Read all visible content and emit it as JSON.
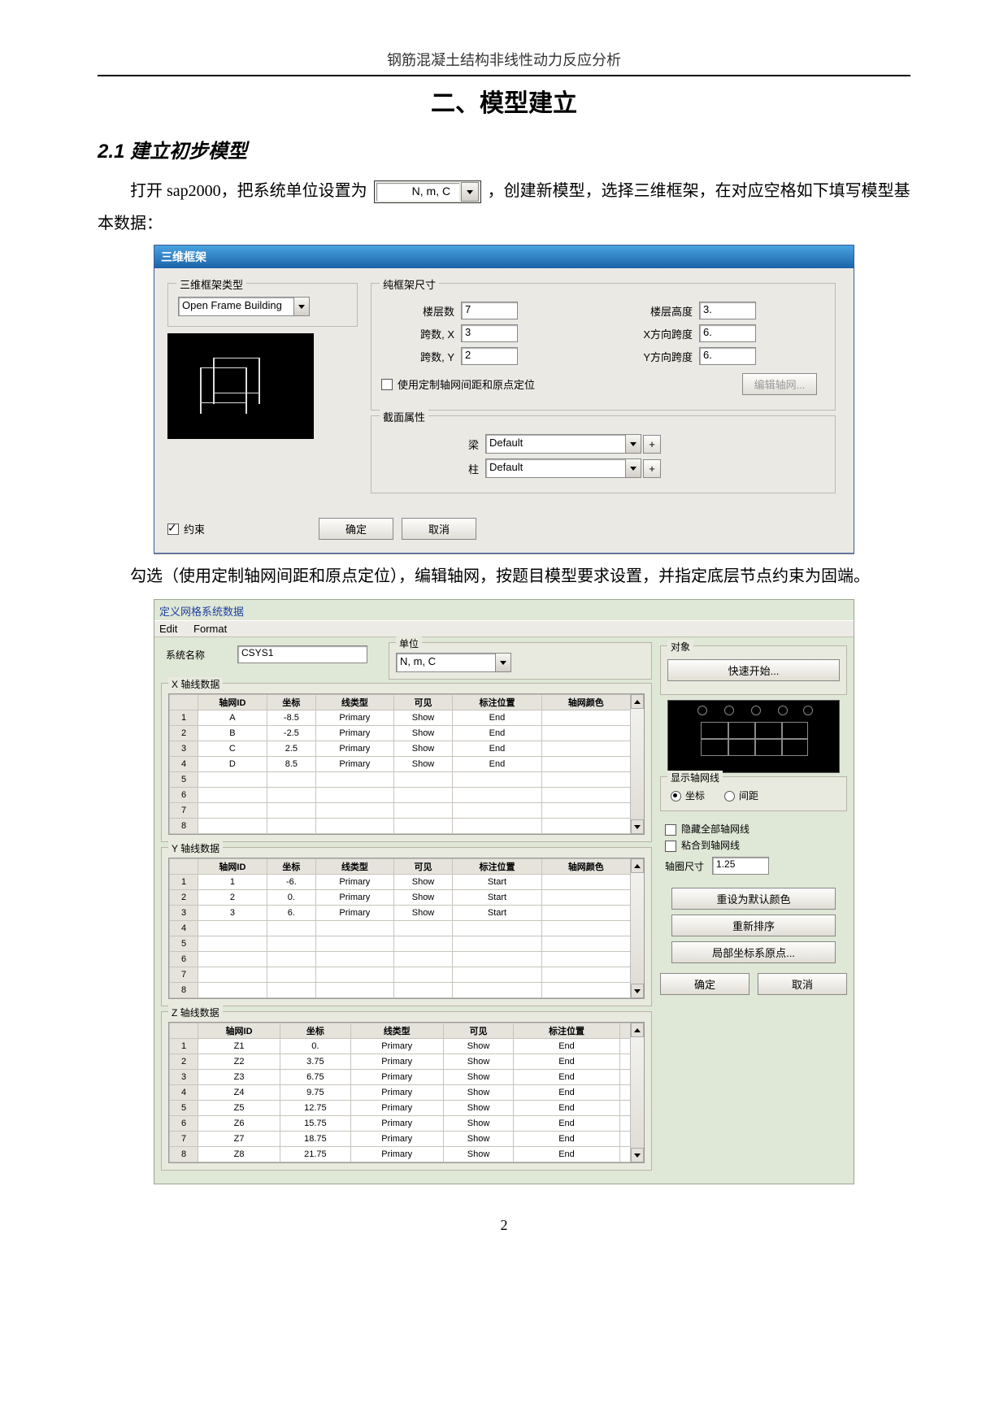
{
  "document": {
    "running_head": "钢筋混凝土结构非线性动力反应分析",
    "chapter_title": "二、模型建立",
    "section_title": "2.1 建立初步模型",
    "para1_before": "打开 sap2000，把系统单位设置为",
    "inline_unit_value": "N, m, C",
    "para1_after": "，创建新模型，选择三维框架，在对应空格如下填写模型基本数据：",
    "para2": "勾选（使用定制轴网间距和原点定位），编辑轴网，按题目模型要求设置，并指定底层节点约束为固端。",
    "page_number": "2"
  },
  "dlg1": {
    "title": "三维框架",
    "grp_type": "三维框架类型",
    "type_value": "Open Frame Building",
    "grp_dim": "纯框架尺寸",
    "lbls": {
      "stories": "楼层数",
      "story_h": "楼层高度",
      "bays_x": "跨数, X",
      "span_x": "X方向跨度",
      "bays_y": "跨数, Y",
      "span_y": "Y方向跨度"
    },
    "vals": {
      "stories": "7",
      "story_h": "3.",
      "bays_x": "3",
      "span_x": "6.",
      "bays_y": "2",
      "span_y": "6."
    },
    "use_custom_grid": "使用定制轴网间距和原点定位",
    "edit_grid_btn": "编辑轴网...",
    "grp_section": "截面属性",
    "beam_lbl": "梁",
    "column_lbl": "柱",
    "beam_val": "Default",
    "column_val": "Default",
    "plus": "+",
    "constraint_chk": "约束",
    "ok": "确定",
    "cancel": "取消"
  },
  "dlg2": {
    "caption": "定义网格系统数据",
    "menu_edit": "Edit",
    "menu_format": "Format",
    "sysname_lbl": "系统名称",
    "sysname_val": "CSYS1",
    "grp_unit": "单位",
    "unit_val": "N, m, C",
    "grp_obj": "对象",
    "quick_start_btn": "快速开始...",
    "grp_x": "X 轴线数据",
    "grp_y": "Y 轴线数据",
    "grp_z": "Z 轴线数据",
    "headers": {
      "id": "轴网ID",
      "coord": "坐标",
      "ltype": "线类型",
      "visible": "可见",
      "bubble": "标注位置",
      "color": "轴网颜色"
    },
    "x_rows": [
      {
        "n": "1",
        "id": "A",
        "coord": "-8.5",
        "lt": "Primary",
        "vis": "Show",
        "bub": "End"
      },
      {
        "n": "2",
        "id": "B",
        "coord": "-2.5",
        "lt": "Primary",
        "vis": "Show",
        "bub": "End"
      },
      {
        "n": "3",
        "id": "C",
        "coord": "2.5",
        "lt": "Primary",
        "vis": "Show",
        "bub": "End"
      },
      {
        "n": "4",
        "id": "D",
        "coord": "8.5",
        "lt": "Primary",
        "vis": "Show",
        "bub": "End"
      },
      {
        "n": "5",
        "id": "",
        "coord": "",
        "lt": "",
        "vis": "",
        "bub": ""
      },
      {
        "n": "6",
        "id": "",
        "coord": "",
        "lt": "",
        "vis": "",
        "bub": ""
      },
      {
        "n": "7",
        "id": "",
        "coord": "",
        "lt": "",
        "vis": "",
        "bub": ""
      },
      {
        "n": "8",
        "id": "",
        "coord": "",
        "lt": "",
        "vis": "",
        "bub": ""
      }
    ],
    "y_rows": [
      {
        "n": "1",
        "id": "1",
        "coord": "-6.",
        "lt": "Primary",
        "vis": "Show",
        "bub": "Start"
      },
      {
        "n": "2",
        "id": "2",
        "coord": "0.",
        "lt": "Primary",
        "vis": "Show",
        "bub": "Start"
      },
      {
        "n": "3",
        "id": "3",
        "coord": "6.",
        "lt": "Primary",
        "vis": "Show",
        "bub": "Start"
      },
      {
        "n": "4",
        "id": "",
        "coord": "",
        "lt": "",
        "vis": "",
        "bub": ""
      },
      {
        "n": "5",
        "id": "",
        "coord": "",
        "lt": "",
        "vis": "",
        "bub": ""
      },
      {
        "n": "6",
        "id": "",
        "coord": "",
        "lt": "",
        "vis": "",
        "bub": ""
      },
      {
        "n": "7",
        "id": "",
        "coord": "",
        "lt": "",
        "vis": "",
        "bub": ""
      },
      {
        "n": "8",
        "id": "",
        "coord": "",
        "lt": "",
        "vis": "",
        "bub": ""
      }
    ],
    "z_rows": [
      {
        "n": "1",
        "id": "Z1",
        "coord": "0.",
        "lt": "Primary",
        "vis": "Show",
        "bub": "End"
      },
      {
        "n": "2",
        "id": "Z2",
        "coord": "3.75",
        "lt": "Primary",
        "vis": "Show",
        "bub": "End"
      },
      {
        "n": "3",
        "id": "Z3",
        "coord": "6.75",
        "lt": "Primary",
        "vis": "Show",
        "bub": "End"
      },
      {
        "n": "4",
        "id": "Z4",
        "coord": "9.75",
        "lt": "Primary",
        "vis": "Show",
        "bub": "End"
      },
      {
        "n": "5",
        "id": "Z5",
        "coord": "12.75",
        "lt": "Primary",
        "vis": "Show",
        "bub": "End"
      },
      {
        "n": "6",
        "id": "Z6",
        "coord": "15.75",
        "lt": "Primary",
        "vis": "Show",
        "bub": "End"
      },
      {
        "n": "7",
        "id": "Z7",
        "coord": "18.75",
        "lt": "Primary",
        "vis": "Show",
        "bub": "End"
      },
      {
        "n": "8",
        "id": "Z8",
        "coord": "21.75",
        "lt": "Primary",
        "vis": "Show",
        "bub": "End"
      }
    ],
    "grp_show": "显示轴网线",
    "radio_coord": "坐标",
    "radio_spacing": "间距",
    "chk_hide_all": "隐藏全部轴网线",
    "chk_paste": "粘合到轴网线",
    "bubble_size_lbl": "轴圈尺寸",
    "bubble_size_val": "1.25",
    "reset_color_btn": "重设为默认颜色",
    "resort_btn": "重新排序",
    "local_origin_btn": "局部坐标系原点...",
    "ok": "确定",
    "cancel": "取消"
  }
}
